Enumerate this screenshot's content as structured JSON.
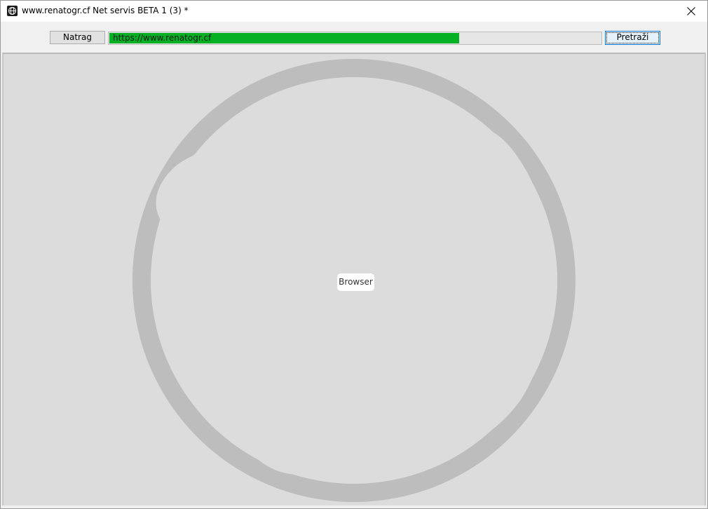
{
  "window": {
    "title": "www.renatogr.cf Net servis BETA 1 (3) *",
    "app_icon": "globe-icon",
    "close_icon": "close-icon"
  },
  "toolbar": {
    "back_label": "Natrag",
    "address_value": "https://www.renatogr.cf",
    "load_progress_percent": 71,
    "search_label": "Pretraži"
  },
  "content": {
    "placeholder_icon": "globe-icon",
    "placeholder_label": "Browser"
  },
  "colors": {
    "progress": "#06b025",
    "content_background": "#dcdcdc",
    "globe": "#bdbdbd"
  }
}
